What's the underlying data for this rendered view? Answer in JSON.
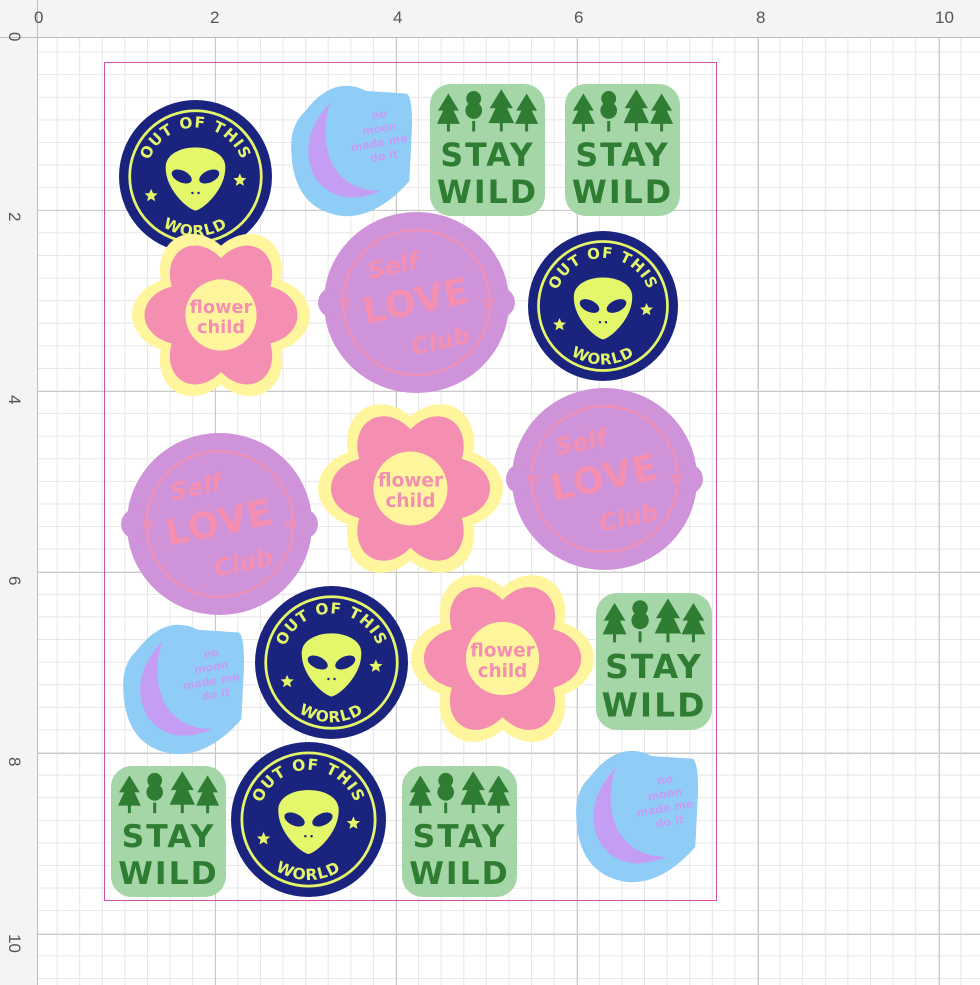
{
  "ruler": {
    "top_labels": [
      "0",
      "2",
      "4",
      "6",
      "8",
      "10"
    ],
    "left_labels": [
      "0",
      "2",
      "4",
      "6",
      "8",
      "10"
    ]
  },
  "colors": {
    "navy": "#1a237e",
    "alien_green": "#e4f76b",
    "moon_blue": "#8fcdf7",
    "moon_purple": "#c49ef5",
    "forest_green": "#2e7d32",
    "mint": "#a5d6a7",
    "pink": "#f48fb1",
    "pale_yellow": "#fff59d",
    "lilac": "#ce93d8",
    "mat_border": "#d24ea4"
  },
  "sticker_text": {
    "alien_top": "OUT OF THIS",
    "alien_bottom": "WORLD",
    "stay": "STAY",
    "wild": "WILD",
    "flower_line1": "flower",
    "flower_line2": "child",
    "self": "Self",
    "love": "LOVE",
    "club": "Club",
    "moon_line1": "no",
    "moon_line2": "moon",
    "moon_line3": "made me",
    "moon_line4": "do it"
  }
}
